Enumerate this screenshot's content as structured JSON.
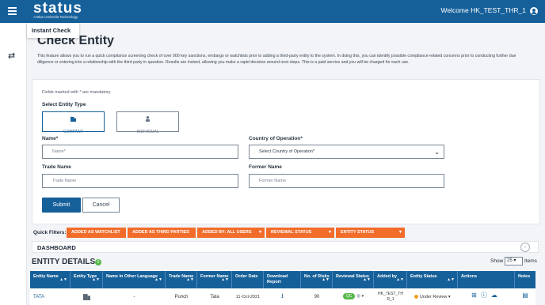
{
  "header": {
    "logo_text": "status",
    "logo_tagline": "A Blue Umbrella Technology",
    "welcome": "Welcome HK_TEST_THR_1"
  },
  "tab": {
    "label": "Instant Check"
  },
  "page": {
    "title": "Check Entity",
    "intro": "This feature allows you to run a quick compliance screening check of over 900 key sanctions, embargo or watchlists prior to adding a third-party entity to the system. In doing this, you can identify possible compliance-related concerns prior to conducting further due diligence or entering into a relationship with the third party in question. Results are instant, allowing you make a rapid decision around next steps. This is a paid service and you will be charged for each use."
  },
  "form": {
    "mandatory_note": "Fields marked with * are mandatory",
    "entity_type_label": "Select Entity Type",
    "types": [
      {
        "label": "COMPANY",
        "selected": true
      },
      {
        "label": "INDIVIDUAL",
        "selected": false
      }
    ],
    "name": {
      "label": "Name*",
      "placeholder": "Name*",
      "value": ""
    },
    "country": {
      "label": "Country of Operation*",
      "selected": "Select Country of Operation*"
    },
    "trade_name": {
      "label": "Trade Name",
      "placeholder": "Trade Name",
      "value": ""
    },
    "former_name": {
      "label": "Former Name",
      "placeholder": "Former Name",
      "value": ""
    },
    "submit_label": "Submit",
    "cancel_label": "Cancel"
  },
  "quick_filters": {
    "label": "Quick Filters:",
    "buttons": [
      "ADDED AS WATCHLIST",
      "ADDED AS THIRD PARTIES",
      "ADDED BY: ALL USERS",
      "REVIEWAL STATUS",
      "ENTITY STATUS"
    ]
  },
  "dashboard": {
    "label": "DASHBOARD"
  },
  "entity_details": {
    "title": "ENTITY DETAILS",
    "badge": "0",
    "show_label": "Show",
    "page_size": "25",
    "items_label": "Items",
    "columns": [
      "Entity Name",
      "Entity Type",
      "Name in Other Language",
      "Trade Name",
      "Former Name",
      "Order Date",
      "Download Report",
      "No. of Risks",
      "Reviewal Status",
      "Added by",
      "Entity Status",
      "Actions",
      "Notes"
    ],
    "rows": [
      {
        "entity_name": "TATA",
        "other_language": "-",
        "trade_name": "Punch",
        "former_name": "Tata",
        "order_date": "11-Oct-2021",
        "risks": "90",
        "reviewal_status": "QC",
        "added_by": "HK_TEST_THR_1",
        "entity_status": "Under Review"
      }
    ]
  },
  "colors": {
    "brand": "#16609a",
    "filter": "#f26c2a",
    "ok": "#55b84a"
  }
}
